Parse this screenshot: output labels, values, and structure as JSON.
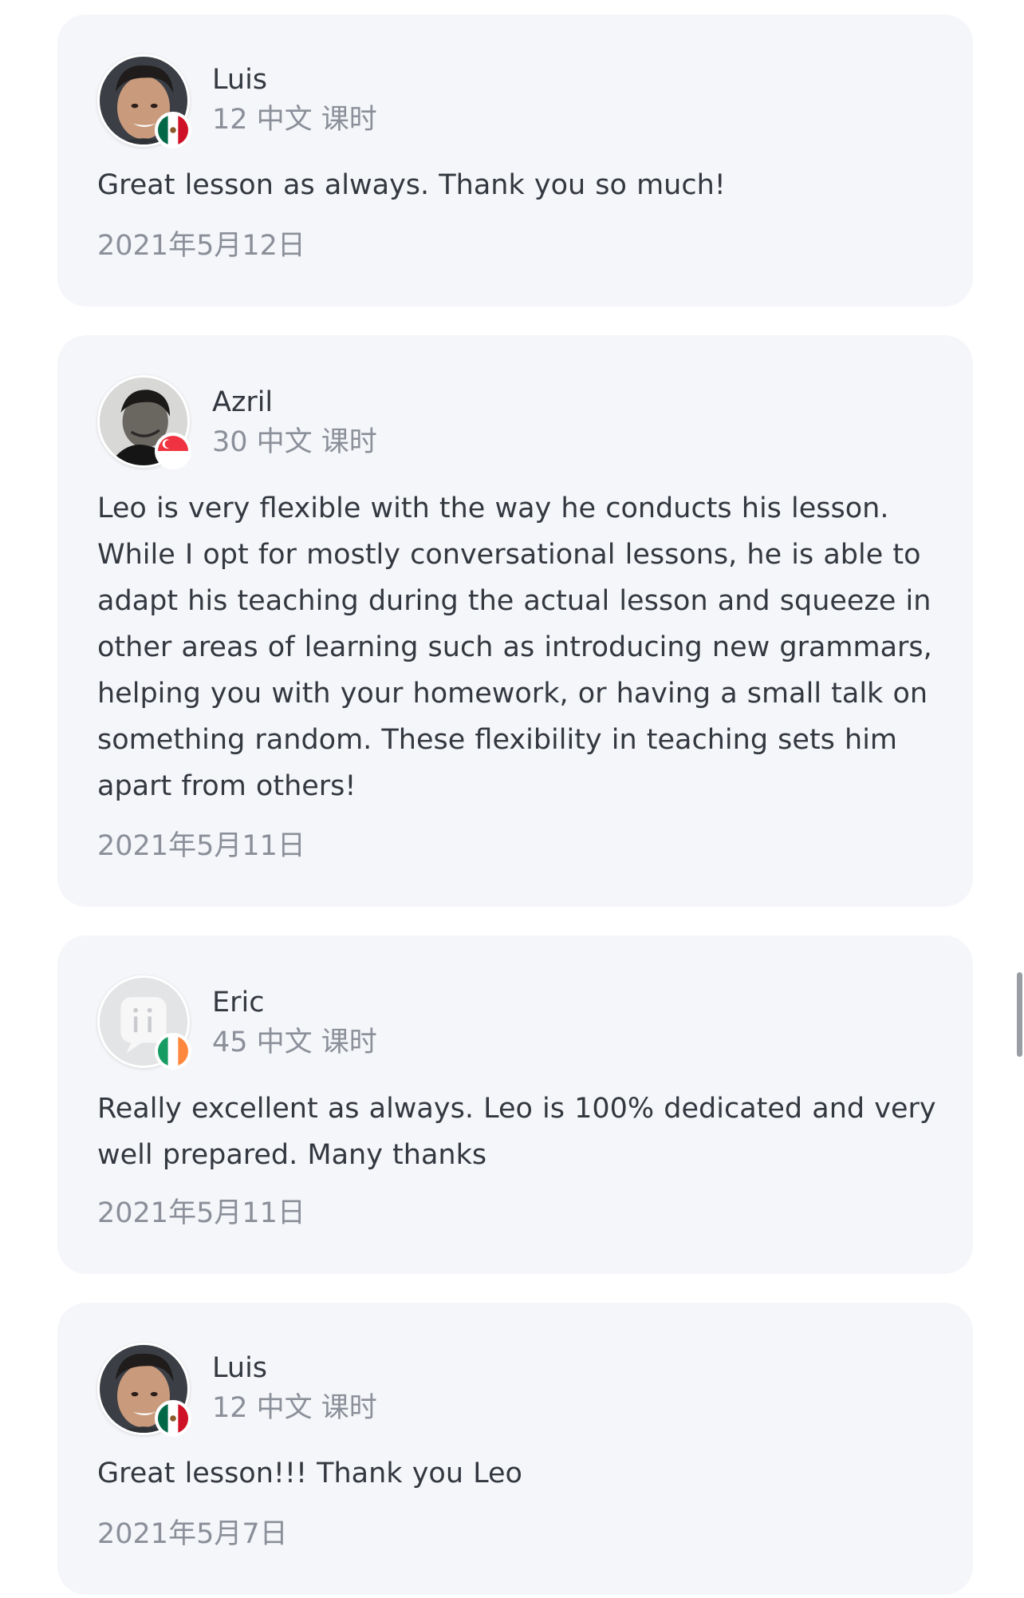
{
  "reviews": [
    {
      "name": "Luis",
      "lessons": "12 中文 课时",
      "text": "Great lesson as always. Thank you so much!",
      "date": "2021年5月12日",
      "flag": "mexico-flag",
      "avatar": "luis-photo"
    },
    {
      "name": "Azril",
      "lessons": "30 中文 课时",
      "text": "Leo is very flexible with the way he conducts his lesson. While I opt for mostly conversational lessons, he is able to adapt his teaching during the actual lesson and squeeze in other areas of learning such as introducing new grammars, helping you with your homework, or having a small talk on something random. These flexibility in teaching sets him apart from others!",
      "date": "2021年5月11日",
      "flag": "singapore-flag",
      "avatar": "azril-photo"
    },
    {
      "name": "Eric",
      "lessons": "45 中文 课时",
      "text": "Really excellent as always.  Leo is 100% dedicated and very well prepared.  Many thanks",
      "date": "2021年5月11日",
      "flag": "ireland-flag",
      "avatar": "default-avatar-icon"
    },
    {
      "name": "Luis",
      "lessons": "12 中文 课时",
      "text": "Great lesson!!! Thank you Leo",
      "date": "2021年5月7日",
      "flag": "mexico-flag",
      "avatar": "luis-photo"
    }
  ],
  "colors": {
    "card_bg": "#f5f6f9",
    "text": "#333840",
    "muted": "#8a8f99",
    "scrollbar": "#9a9da3"
  }
}
